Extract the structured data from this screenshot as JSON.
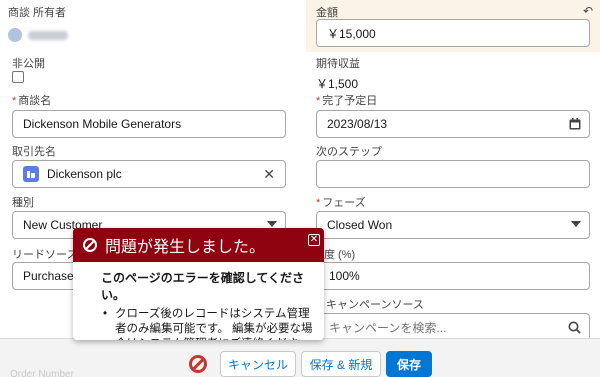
{
  "left": {
    "owner_label": "商談 所有者",
    "private_label": "非公開",
    "name_label": "商談名",
    "name_value": "Dickenson Mobile Generators",
    "account_label": "取引先名",
    "account_value": "Dickenson plc",
    "type_label": "種別",
    "type_value": "New Customer",
    "lead_label": "リードソース",
    "lead_value": "Purchased"
  },
  "right": {
    "amount_label": "金額",
    "amount_value": "￥15,000",
    "expected_label": "期待収益",
    "expected_value": "￥1,500",
    "close_label": "完了予定日",
    "close_value": "2023/08/13",
    "next_label": "次のステップ",
    "next_value": "",
    "stage_label": "フェーズ",
    "stage_value": "Closed Won",
    "prob_label": "度 (%)",
    "prob_value": "100%",
    "campaign_label": "キャンペーンソース",
    "campaign_placeholder": "キャンペーンを検索..."
  },
  "required_mark": "*",
  "popover": {
    "title": "問題が発生しました。",
    "heading": "このページのエラーを確認してください。",
    "message": "クローズ後のレコードはシステム管理者のみ編集可能です。 編集が必要な場合はシステム管理者にご連絡ください。"
  },
  "footer": {
    "cancel": "キャンセル",
    "save_new": "保存 & 新規",
    "save": "保存",
    "faded": "Order Number"
  },
  "colors": {
    "brand": "#0176d3",
    "error": "#8e030f",
    "edited_bg": "#faf3e6"
  }
}
